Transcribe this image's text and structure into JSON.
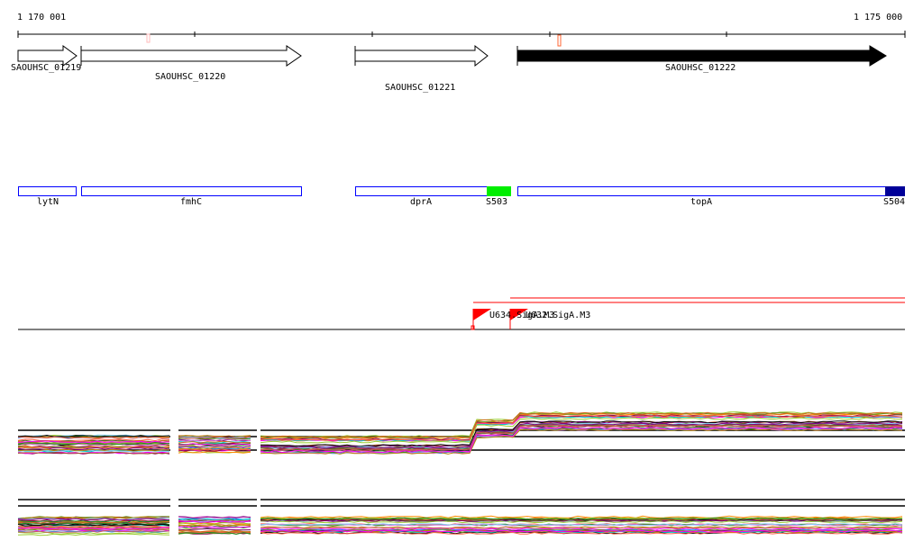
{
  "ruler": {
    "start_label": "1 170 001",
    "end_label": "1 175 000"
  },
  "genes": [
    {
      "label": "SAOUHSC_01219",
      "filled": false
    },
    {
      "label": "SAOUHSC_01220",
      "filled": false
    },
    {
      "label": "SAOUHSC_01221",
      "filled": false
    },
    {
      "label": "SAOUHSC_01222",
      "filled": true
    }
  ],
  "annotations": [
    {
      "label": "lytN"
    },
    {
      "label": "fmhC"
    },
    {
      "label": "dprA"
    },
    {
      "label": "S503",
      "color": "#00ee00"
    },
    {
      "label": "topA"
    },
    {
      "label": "S504",
      "color": "#000099"
    }
  ],
  "promoters": [
    {
      "label": "U634.SigA.M3",
      "color": "#ff0000"
    },
    {
      "label": "U632.SigA.M3",
      "color": "#ff0000"
    }
  ],
  "colors": {
    "line_palette": [
      "#000000",
      "#8b0a50",
      "#6b8e23",
      "#ff6347",
      "#d2691e",
      "#9acd32",
      "#87cefa",
      "#800080",
      "#b8860b",
      "#cd5c5c",
      "#228b22",
      "#ff00ff",
      "#a0522d",
      "#1e90ff",
      "#da70d6",
      "#556b2f",
      "#ff8c00",
      "#00ced1"
    ]
  }
}
